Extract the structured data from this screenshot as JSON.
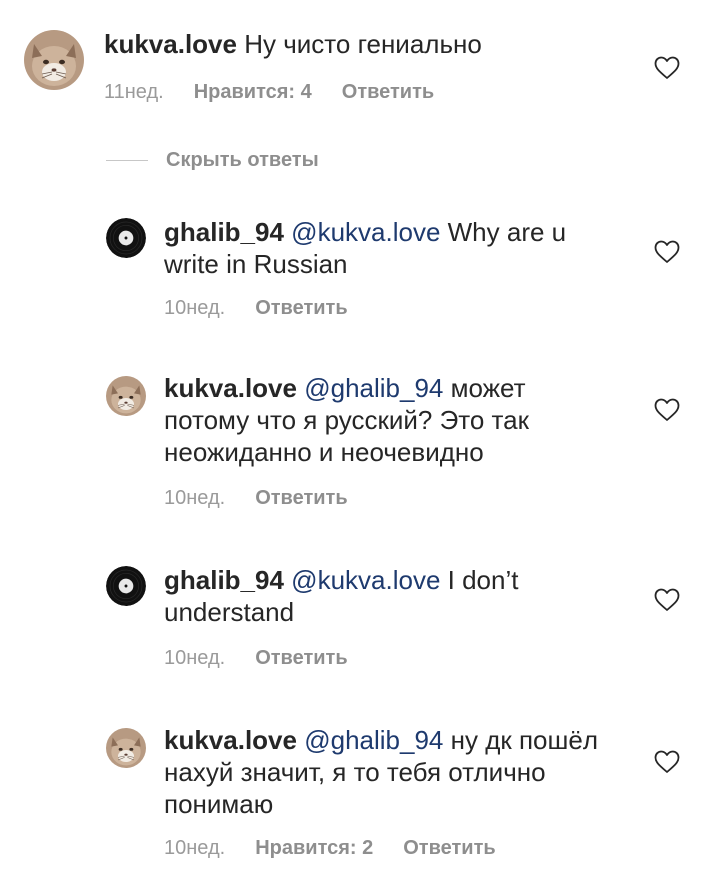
{
  "comments": [
    {
      "username": "kukva.love",
      "mention": "",
      "text": " Ну чисто гениально",
      "time": "11нед.",
      "likes": "Нравится: 4",
      "reply": "Ответить"
    },
    {
      "username": "ghalib_94",
      "mention": "@kukva.love",
      "text": " Why are u write in Russian",
      "time": "10нед.",
      "likes": "",
      "reply": "Ответить"
    },
    {
      "username": "kukva.love",
      "mention": "@ghalib_94",
      "text": " может потому что я русский? Это так неожиданно и неочевидно",
      "time": "10нед.",
      "likes": "",
      "reply": "Ответить"
    },
    {
      "username": "ghalib_94",
      "mention": "@kukva.love",
      "text": " I don’t understand",
      "time": "10нед.",
      "likes": "",
      "reply": "Ответить"
    },
    {
      "username": "kukva.love",
      "mention": "@ghalib_94",
      "text": " ну дк пошёл нахуй значит, я то тебя отлично понимаю",
      "time": "10нед.",
      "likes": "Нравится: 2",
      "reply": "Ответить"
    }
  ],
  "hide_replies": "Скрыть ответы",
  "icons": {
    "like": "heart-outline-icon",
    "avatar_kukva": "cat-avatar",
    "avatar_ghalib": "vinyl-record-avatar"
  },
  "colors": {
    "text": "#262626",
    "meta": "#8e8e8e",
    "mention": "#1e3a6e"
  }
}
